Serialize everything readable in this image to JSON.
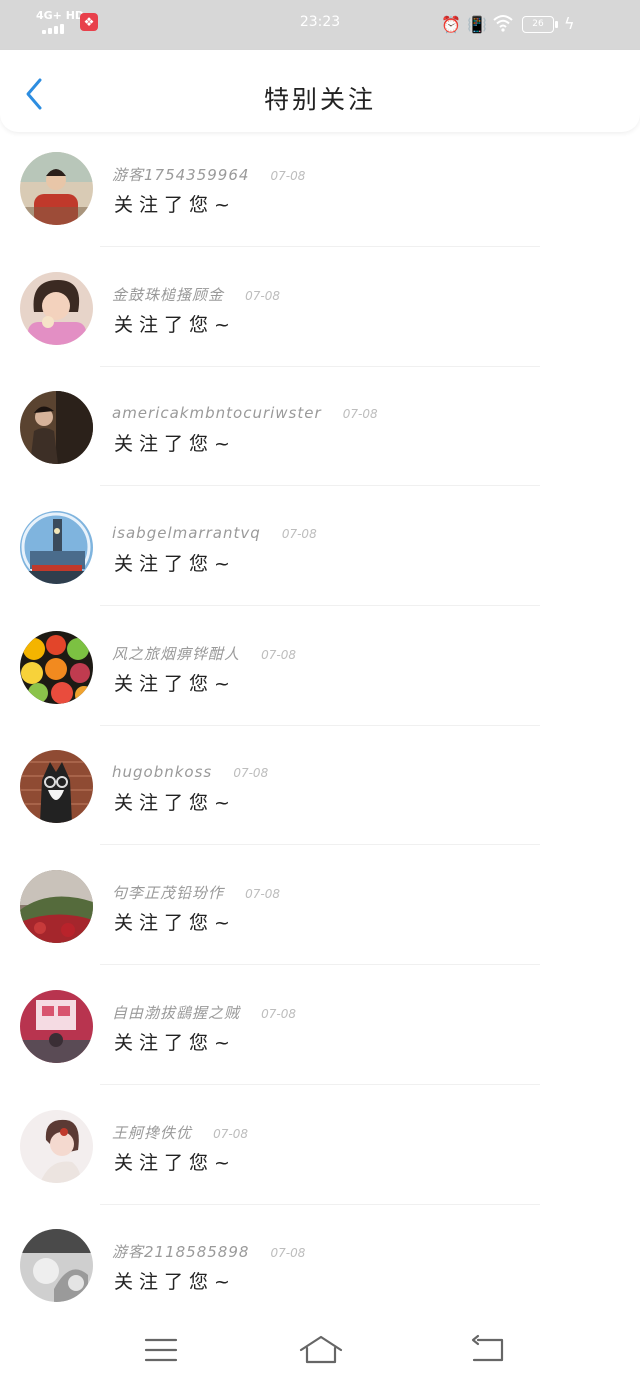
{
  "status_bar": {
    "network": "4G+ HD",
    "time": "23:23",
    "battery": "26",
    "icons": [
      "signal-icon",
      "app-badge-icon",
      "alarm-icon",
      "vibrate-icon",
      "wifi-icon",
      "battery-icon",
      "charging-icon"
    ]
  },
  "header": {
    "title": "特别关注",
    "back_icon": "chevron-left-icon",
    "accent_color": "#2d8de0"
  },
  "items": [
    {
      "name": "游客1754359964",
      "date": "07-08",
      "action": "关注了您~",
      "avatar": "girl-red-top"
    },
    {
      "name": "金鼓珠槌搔顾金",
      "date": "07-08",
      "action": "关注了您~",
      "avatar": "toddler-pink"
    },
    {
      "name": "americakmbntocuriwster",
      "date": "07-08",
      "action": "关注了您~",
      "avatar": "woman-dark-room"
    },
    {
      "name": "isabgelmarrantvq",
      "date": "07-08",
      "action": "关注了您~",
      "avatar": "city-clock-tower"
    },
    {
      "name": "风之旅烟痹铧酣人",
      "date": "07-08",
      "action": "关注了您~",
      "avatar": "citrus-fruits"
    },
    {
      "name": "hugobnkoss",
      "date": "07-08",
      "action": "关注了您~",
      "avatar": "husky-glasses"
    },
    {
      "name": "句李正茂铅玢作",
      "date": "07-08",
      "action": "关注了您~",
      "avatar": "red-flower-hill"
    },
    {
      "name": "自由渤拔鷂握之贼",
      "date": "07-08",
      "action": "关注了您~",
      "avatar": "pink-wall-person"
    },
    {
      "name": "王舸搀佚优",
      "date": "07-08",
      "action": "关注了您~",
      "avatar": "woman-portrait-light"
    },
    {
      "name": "游客2118585898",
      "date": "07-08",
      "action": "关注了您~",
      "avatar": "grey-photo"
    }
  ],
  "nav": {
    "icons": [
      "menu-icon",
      "home-icon",
      "back-icon"
    ]
  }
}
